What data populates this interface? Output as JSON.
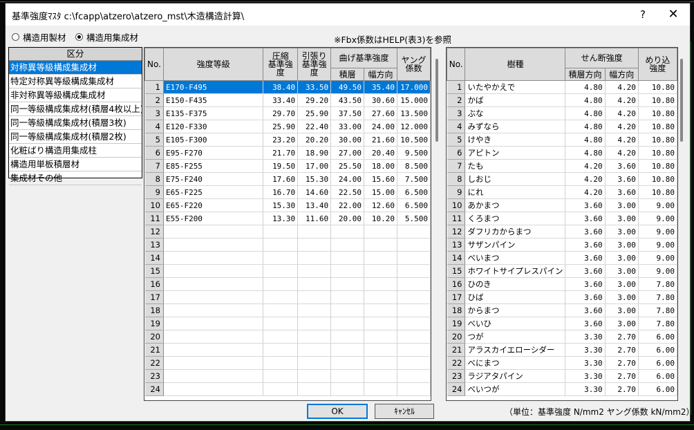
{
  "window": {
    "title": "基準強度ﾏｽﾀ c:\\fcapp\\atzero\\atzero_mst\\木造構造計算\\",
    "help_label": "?",
    "close_label": "✕"
  },
  "radios": [
    {
      "label": "構造用製材",
      "selected": false
    },
    {
      "label": "構造用集成材",
      "selected": true
    }
  ],
  "note": "※Fbx係数はHELP(表3)を参照",
  "category": {
    "header": "区分",
    "items": [
      "対称異等級構成集成材",
      "特定対称異等級構成集成材",
      "非対称異等級構成集成材",
      "同一等級構成集成材(積層4枚以上)",
      "同一等級構成集成材(積層3枚)",
      "同一等級構成集成材(積層2枚)",
      "化粧ばり構造用集成柱",
      "構造用単板積層材",
      "集成材その他"
    ],
    "selected_index": 0
  },
  "strength_table": {
    "headers": {
      "no": "No.",
      "grade": "強度等級",
      "compression": "圧縮\n基準強\n度",
      "tension": "引張り\n基準強\n度",
      "bending": "曲げ基準強度",
      "bending_layer": "積層",
      "bending_width": "幅方向",
      "young": "ヤング\n係数"
    },
    "selected_row": 0,
    "rows": [
      {
        "no": "1",
        "grade": "E170-F495",
        "c": "38.40",
        "t": "33.50",
        "b1": "49.50",
        "b2": "35.40",
        "e": "17.000"
      },
      {
        "no": "2",
        "grade": "E150-F435",
        "c": "33.40",
        "t": "29.20",
        "b1": "43.50",
        "b2": "30.60",
        "e": "15.000"
      },
      {
        "no": "3",
        "grade": "E135-F375",
        "c": "29.70",
        "t": "25.90",
        "b1": "37.50",
        "b2": "27.60",
        "e": "13.500"
      },
      {
        "no": "4",
        "grade": "E120-F330",
        "c": "25.90",
        "t": "22.40",
        "b1": "33.00",
        "b2": "24.00",
        "e": "12.000"
      },
      {
        "no": "5",
        "grade": "E105-F300",
        "c": "23.20",
        "t": "20.20",
        "b1": "30.00",
        "b2": "21.60",
        "e": "10.500"
      },
      {
        "no": "6",
        "grade": "E95-F270",
        "c": "21.70",
        "t": "18.90",
        "b1": "27.00",
        "b2": "20.40",
        "e": "9.500"
      },
      {
        "no": "7",
        "grade": "E85-F255",
        "c": "19.50",
        "t": "17.00",
        "b1": "25.50",
        "b2": "18.00",
        "e": "8.500"
      },
      {
        "no": "8",
        "grade": "E75-F240",
        "c": "17.60",
        "t": "15.30",
        "b1": "24.00",
        "b2": "15.60",
        "e": "7.500"
      },
      {
        "no": "9",
        "grade": "E65-F225",
        "c": "16.70",
        "t": "14.60",
        "b1": "22.50",
        "b2": "15.00",
        "e": "6.500"
      },
      {
        "no": "10",
        "grade": "E65-F220",
        "c": "15.30",
        "t": "13.40",
        "b1": "22.00",
        "b2": "12.60",
        "e": "6.500"
      },
      {
        "no": "11",
        "grade": "E55-F200",
        "c": "13.30",
        "t": "11.60",
        "b1": "20.00",
        "b2": "10.20",
        "e": "5.500"
      },
      {
        "no": "12",
        "grade": "",
        "c": "",
        "t": "",
        "b1": "",
        "b2": "",
        "e": ""
      },
      {
        "no": "13",
        "grade": "",
        "c": "",
        "t": "",
        "b1": "",
        "b2": "",
        "e": ""
      },
      {
        "no": "14",
        "grade": "",
        "c": "",
        "t": "",
        "b1": "",
        "b2": "",
        "e": ""
      },
      {
        "no": "15",
        "grade": "",
        "c": "",
        "t": "",
        "b1": "",
        "b2": "",
        "e": ""
      },
      {
        "no": "16",
        "grade": "",
        "c": "",
        "t": "",
        "b1": "",
        "b2": "",
        "e": ""
      },
      {
        "no": "17",
        "grade": "",
        "c": "",
        "t": "",
        "b1": "",
        "b2": "",
        "e": ""
      },
      {
        "no": "18",
        "grade": "",
        "c": "",
        "t": "",
        "b1": "",
        "b2": "",
        "e": ""
      },
      {
        "no": "19",
        "grade": "",
        "c": "",
        "t": "",
        "b1": "",
        "b2": "",
        "e": ""
      },
      {
        "no": "20",
        "grade": "",
        "c": "",
        "t": "",
        "b1": "",
        "b2": "",
        "e": ""
      },
      {
        "no": "21",
        "grade": "",
        "c": "",
        "t": "",
        "b1": "",
        "b2": "",
        "e": ""
      },
      {
        "no": "22",
        "grade": "",
        "c": "",
        "t": "",
        "b1": "",
        "b2": "",
        "e": ""
      },
      {
        "no": "23",
        "grade": "",
        "c": "",
        "t": "",
        "b1": "",
        "b2": "",
        "e": ""
      },
      {
        "no": "24",
        "grade": "",
        "c": "",
        "t": "",
        "b1": "",
        "b2": "",
        "e": ""
      }
    ]
  },
  "species_table": {
    "headers": {
      "no": "No.",
      "species": "樹種",
      "shear": "せん断強度",
      "shear_layer": "積層方向",
      "shear_width": "幅方向",
      "embedment": "めり込\n強度"
    },
    "rows": [
      {
        "no": "1",
        "name": "いたやかえで",
        "s1": "4.80",
        "s2": "4.20",
        "m": "10.80"
      },
      {
        "no": "2",
        "name": "かば",
        "s1": "4.80",
        "s2": "4.20",
        "m": "10.80"
      },
      {
        "no": "3",
        "name": "ぶな",
        "s1": "4.80",
        "s2": "4.20",
        "m": "10.80"
      },
      {
        "no": "4",
        "name": "みずなら",
        "s1": "4.80",
        "s2": "4.20",
        "m": "10.80"
      },
      {
        "no": "5",
        "name": "けやき",
        "s1": "4.80",
        "s2": "4.20",
        "m": "10.80"
      },
      {
        "no": "6",
        "name": "アピトン",
        "s1": "4.80",
        "s2": "4.20",
        "m": "10.80"
      },
      {
        "no": "7",
        "name": "たも",
        "s1": "4.20",
        "s2": "3.60",
        "m": "10.80"
      },
      {
        "no": "8",
        "name": "しおじ",
        "s1": "4.20",
        "s2": "3.60",
        "m": "10.80"
      },
      {
        "no": "9",
        "name": "にれ",
        "s1": "4.20",
        "s2": "3.60",
        "m": "10.80"
      },
      {
        "no": "10",
        "name": "あかまつ",
        "s1": "3.60",
        "s2": "3.00",
        "m": "9.00"
      },
      {
        "no": "11",
        "name": "くろまつ",
        "s1": "3.60",
        "s2": "3.00",
        "m": "9.00"
      },
      {
        "no": "12",
        "name": "ダフリカからまつ",
        "s1": "3.60",
        "s2": "3.00",
        "m": "9.00"
      },
      {
        "no": "13",
        "name": "サザンパイン",
        "s1": "3.60",
        "s2": "3.00",
        "m": "9.00"
      },
      {
        "no": "14",
        "name": "べいまつ",
        "s1": "3.60",
        "s2": "3.00",
        "m": "9.00"
      },
      {
        "no": "15",
        "name": "ホワイトサイプレスパイン",
        "s1": "3.60",
        "s2": "3.00",
        "m": "9.00"
      },
      {
        "no": "16",
        "name": "ひのき",
        "s1": "3.60",
        "s2": "3.00",
        "m": "7.80"
      },
      {
        "no": "17",
        "name": "ひば",
        "s1": "3.60",
        "s2": "3.00",
        "m": "7.80"
      },
      {
        "no": "18",
        "name": "からまつ",
        "s1": "3.60",
        "s2": "3.00",
        "m": "7.80"
      },
      {
        "no": "19",
        "name": "べいひ",
        "s1": "3.60",
        "s2": "3.00",
        "m": "7.80"
      },
      {
        "no": "20",
        "name": "つが",
        "s1": "3.30",
        "s2": "2.70",
        "m": "6.00"
      },
      {
        "no": "21",
        "name": "アラスカイエローシダー",
        "s1": "3.30",
        "s2": "2.70",
        "m": "6.00"
      },
      {
        "no": "22",
        "name": "べにまつ",
        "s1": "3.30",
        "s2": "2.70",
        "m": "6.00"
      },
      {
        "no": "23",
        "name": "ラジアタパイン",
        "s1": "3.30",
        "s2": "2.70",
        "m": "6.00"
      },
      {
        "no": "24",
        "name": "べいつが",
        "s1": "3.30",
        "s2": "2.70",
        "m": "6.00"
      }
    ]
  },
  "buttons": {
    "ok": "OK",
    "cancel": "ｷｬﾝｾﾙ"
  },
  "units_note": "（単位：基準強度 N/mm2  ヤング係数 kN/mm2）",
  "colors": {
    "selection": "#0078d7",
    "background_lines": "#1f7a1f"
  }
}
